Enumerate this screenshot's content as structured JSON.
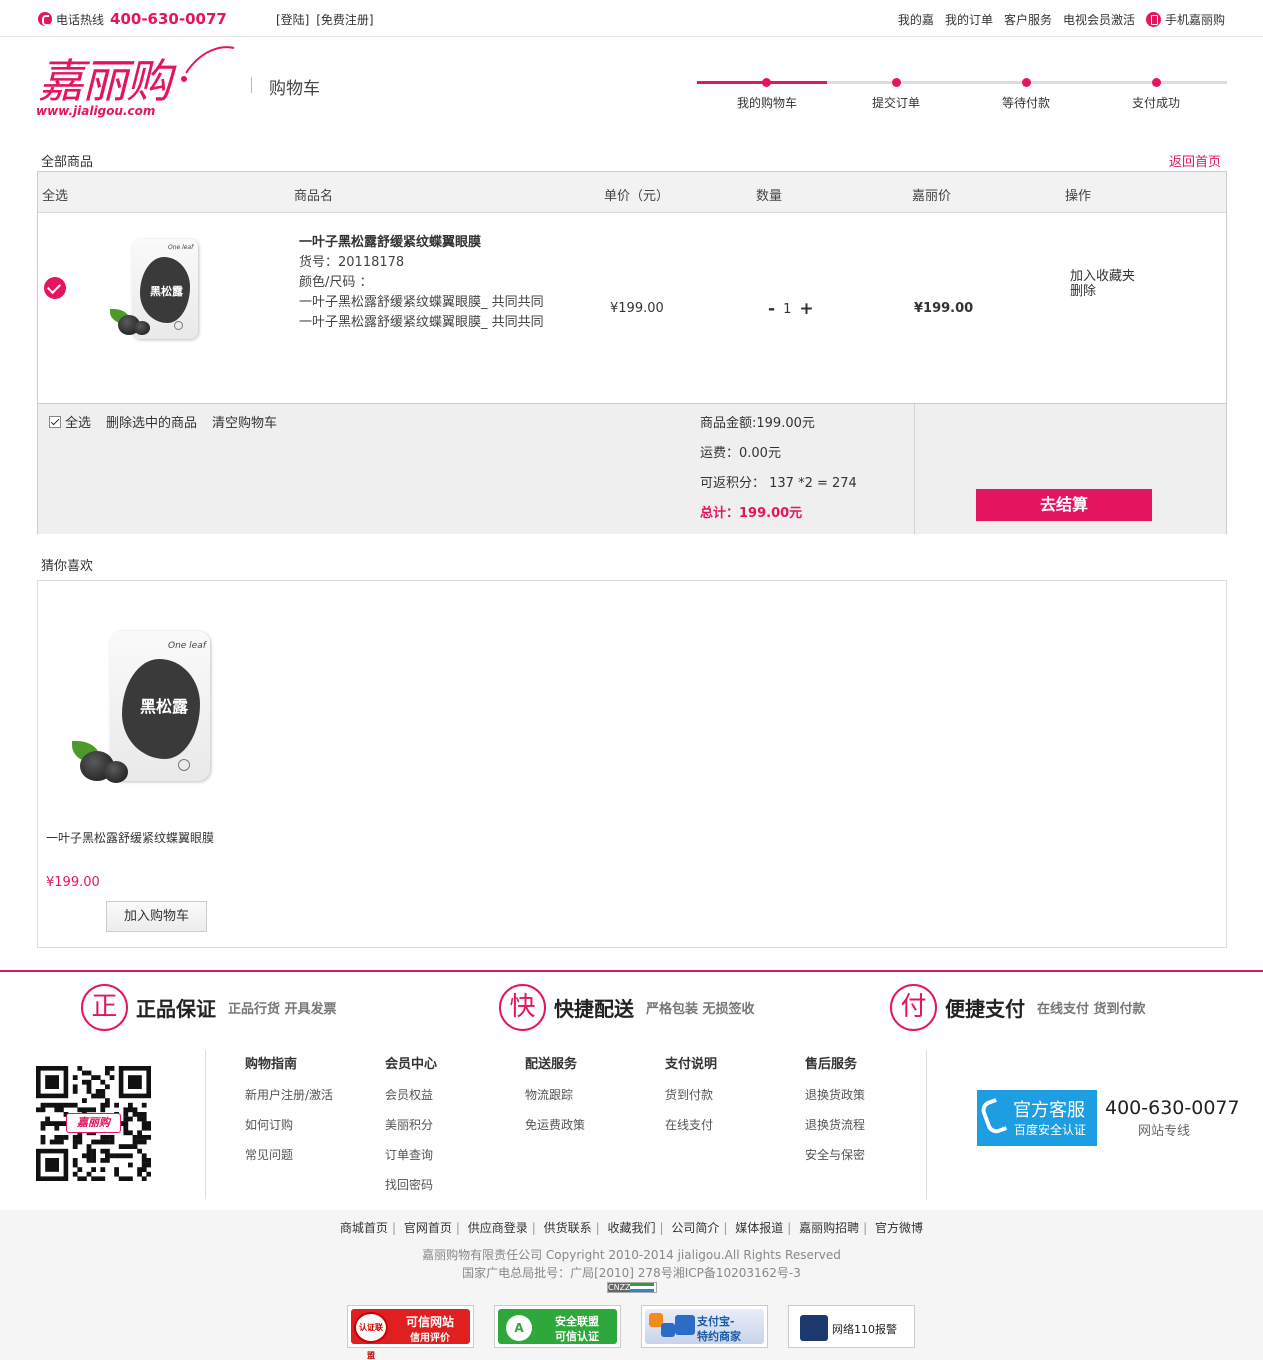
{
  "topbar": {
    "hotline_label": "电话热线",
    "hotline_number": "400-630-0077",
    "login": "[登陆]",
    "register": "[免费注册]",
    "nav": [
      "我的嘉",
      "我的订单",
      "客户服务",
      "电视会员激活"
    ],
    "mobile": "手机嘉丽购"
  },
  "header": {
    "logo_text": "嘉丽购",
    "logo_url": "www.jialigou.com",
    "page_title": "购物车",
    "steps": [
      "我的购物车",
      "提交订单",
      "等待付款",
      "支付成功"
    ],
    "current_step": 1
  },
  "cart": {
    "all_goods": "全部商品",
    "back_home": "返回首页",
    "columns": [
      "全选",
      "商品名",
      "单价（元）",
      "数量",
      "嘉丽价",
      "操作"
    ],
    "item": {
      "name": "一叶子黑松露舒缓紧纹蝶翼眼膜",
      "sku": "货号：20118178",
      "attr_label": "颜色/尺码 ：",
      "attr_line1": "一叶子黑松露舒缓紧纹蝶翼眼膜_ 共同共同",
      "attr_line2": "一叶子黑松露舒缓紧纹蝶翼眼膜_ 共同共同",
      "unit_price": "¥199.00",
      "qty_minus": "-",
      "qty": "1",
      "qty_plus": "+",
      "jiali_price": "¥199.00",
      "op_fav": "加入收藏夹",
      "op_delete": "删除",
      "pack_brand": "One leaf",
      "pack_cn": "黑松露"
    },
    "summary": {
      "select_all": "全选",
      "delete_selected": "删除选中的商品",
      "clear_cart": "清空购物车",
      "goods_amount": "商品金额:199.00元",
      "shipping": "运费：0.00元",
      "points": "可返积分： 137 *2 = 274",
      "total": "总计：199.00元",
      "checkout": "去结算"
    }
  },
  "recommend": {
    "title": "猜你喜欢",
    "item_name": "一叶子黑松露舒缓紧纹蝶翼眼膜",
    "item_price": "¥199.00",
    "add_to_cart": "加入购物车",
    "pack_brand": "One leaf",
    "pack_cn": "黑松露"
  },
  "features": [
    {
      "icon": "正",
      "title": "正品保证",
      "sub": "正品行货 开具发票"
    },
    {
      "icon": "快",
      "title": "快捷配送",
      "sub": "严格包装 无损签收"
    },
    {
      "icon": "付",
      "title": "便捷支付",
      "sub": "在线支付 货到付款"
    }
  ],
  "footer_cols": [
    {
      "title": "购物指南",
      "items": [
        "新用户注册/激活",
        "如何订购",
        "常见问题"
      ]
    },
    {
      "title": "会员中心",
      "items": [
        "会员权益",
        "美丽积分",
        "订单查询",
        "找回密码"
      ]
    },
    {
      "title": "配送服务",
      "items": [
        "物流跟踪",
        "免运费政策"
      ]
    },
    {
      "title": "支付说明",
      "items": [
        "货到付款",
        "在线支付"
      ]
    },
    {
      "title": "售后服务",
      "items": [
        "退换货政策",
        "退换货流程",
        "安全与保密"
      ]
    }
  ],
  "service": {
    "title": "官方客服",
    "subtitle": "百度安全认证",
    "number": "400-630-0077",
    "number_sub": "网站专线"
  },
  "qr_logo": "嘉丽购",
  "bottom": {
    "links": [
      "商城首页",
      "官网首页",
      "供应商登录",
      "供货联系",
      "收藏我们",
      "公司简介",
      "媒体报道",
      "嘉丽购招聘",
      "官方微博"
    ],
    "copyright": "嘉丽购物有限责任公司 Copyright 2010-2014 jialigou.All Rights Reserved",
    "icp": "国家广电总局批号：广局[2010] 278号湘ICP备10203162号-3",
    "cnzz": "CNZZ",
    "badges": [
      {
        "l1": "可信网站",
        "l2": "信用评价",
        "seal": "认证联盟"
      },
      {
        "l1": "安全联盟",
        "l2": "可信认证"
      },
      {
        "l1": "支付宝-",
        "l2": "特约商家"
      },
      {
        "l1": "网络110报警"
      }
    ],
    "colors": {
      "accent": "#e4145e",
      "service_blue": "#1d9de2"
    }
  }
}
